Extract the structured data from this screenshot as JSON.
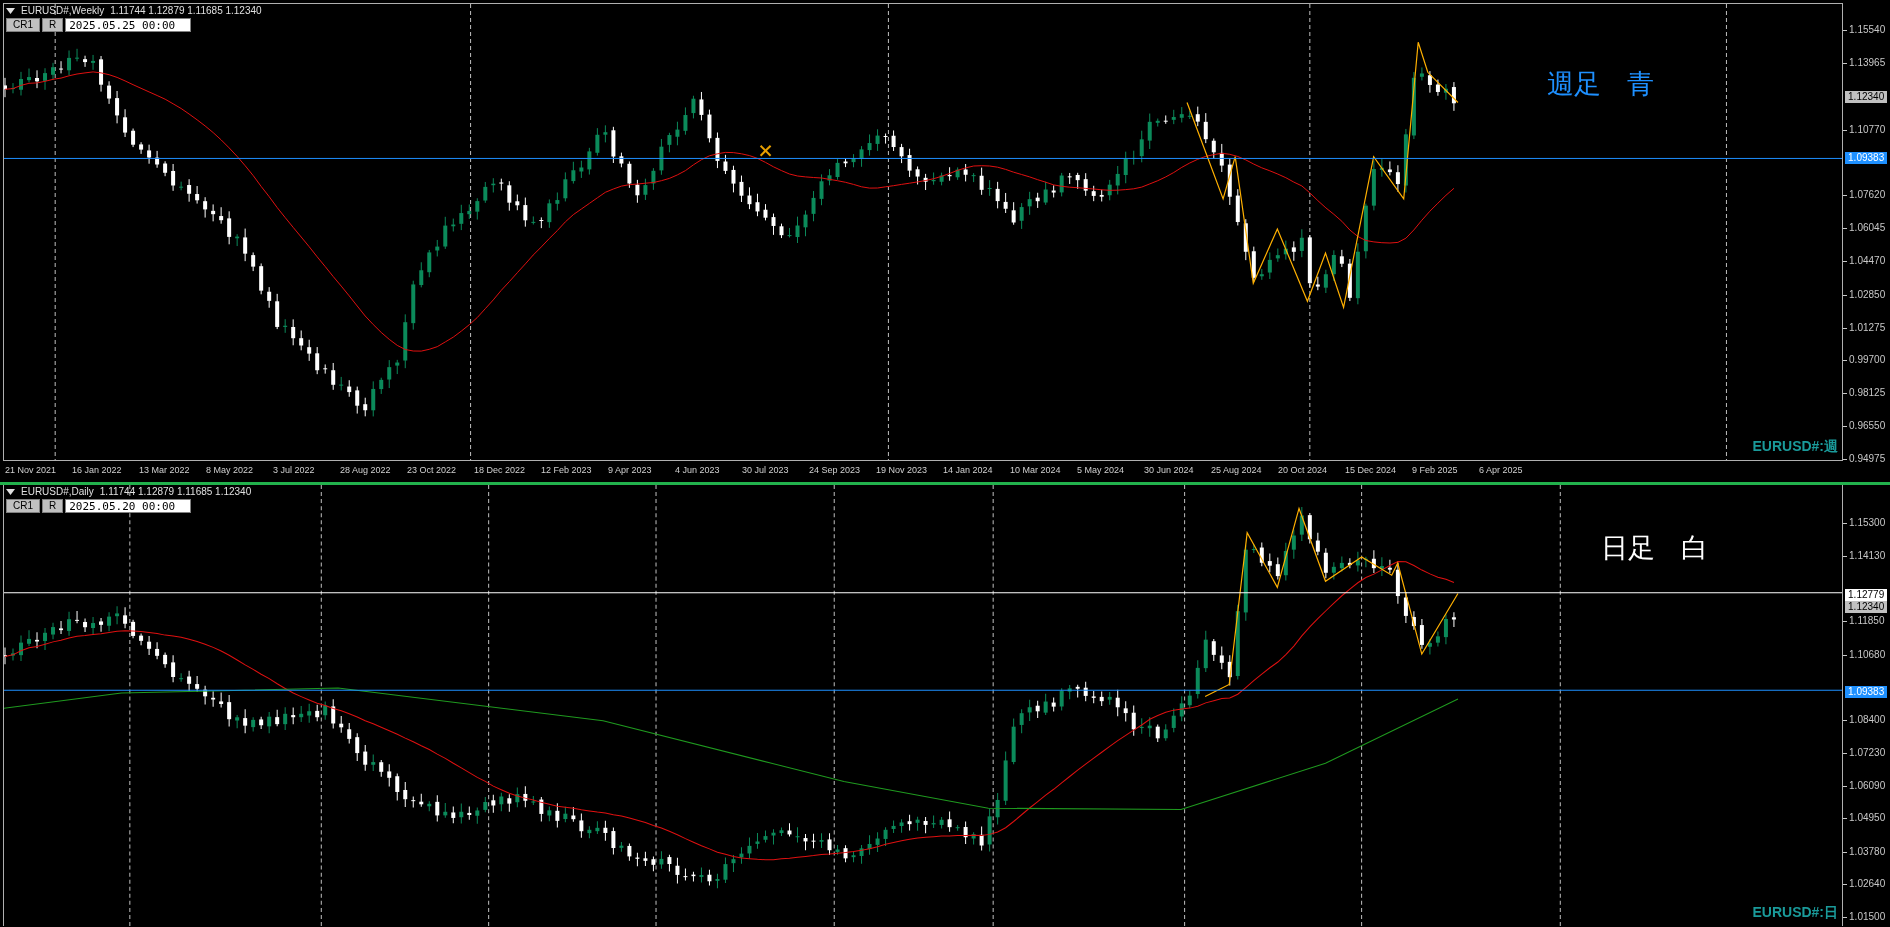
{
  "panels": [
    {
      "symbol": "EURUSD#,Weekly",
      "ohlc": "1.11744 1.12879 1.11685 1.12340",
      "buttons": [
        "CR1",
        "R"
      ],
      "date_field": {
        "value": "2025.05.25 00:00"
      },
      "note": {
        "text": "週足 青",
        "color": "#1e90ff"
      },
      "corner_label": "EURUSD#:週",
      "price_labels": [
        "1.15540",
        "1.13965",
        "1.10770",
        "1.07620",
        "1.06045",
        "1.04470",
        "1.02850",
        "1.01275",
        "0.99700",
        "0.98125",
        "0.96550",
        "0.94975"
      ],
      "price_badges": [
        {
          "kind": "bid",
          "value": "1.12340",
          "color": "#c0c0c0"
        },
        {
          "kind": "line",
          "value": "1.09383",
          "color": "#1e90ff"
        }
      ],
      "time_labels": [
        "21 Nov 2021",
        "16 Jan 2022",
        "13 Mar 2022",
        "8 May 2022",
        "3 Jul 2022",
        "28 Aug 2022",
        "23 Oct 2022",
        "18 Dec 2022",
        "12 Feb 2023",
        "9 Apr 2023",
        "4 Jun 2023",
        "30 Jul 2023",
        "24 Sep 2023",
        "19 Nov 2023",
        "14 Jan 2024",
        "10 Mar 2024",
        "5 May 2024",
        "30 Jun 2024",
        "25 Aug 2024",
        "20 Oct 2024",
        "15 Dec 2024",
        "9 Feb 2025",
        "6 Apr 2025"
      ]
    },
    {
      "symbol": "EURUSD#,Daily",
      "ohlc": "1.11744 1.12879 1.11685 1.12340",
      "buttons": [
        "CR1",
        "R"
      ],
      "date_field": {
        "value": "2025.05.20 00:00"
      },
      "note": {
        "text": "日足 白",
        "color": "#ffffff"
      },
      "corner_label": "EURUSD#:日",
      "price_labels": [
        "1.15300",
        "1.14130",
        "1.11850",
        "1.10680",
        "1.08400",
        "1.07230",
        "1.06090",
        "1.04950",
        "1.03780",
        "1.02640",
        "1.01500"
      ],
      "price_badges": [
        {
          "kind": "line",
          "value": "1.12779",
          "color": "#ffffff"
        },
        {
          "kind": "bid",
          "value": "1.12340",
          "color": "#c0c0c0"
        },
        {
          "kind": "line",
          "value": "1.09383",
          "color": "#1e90ff"
        }
      ]
    }
  ]
}
